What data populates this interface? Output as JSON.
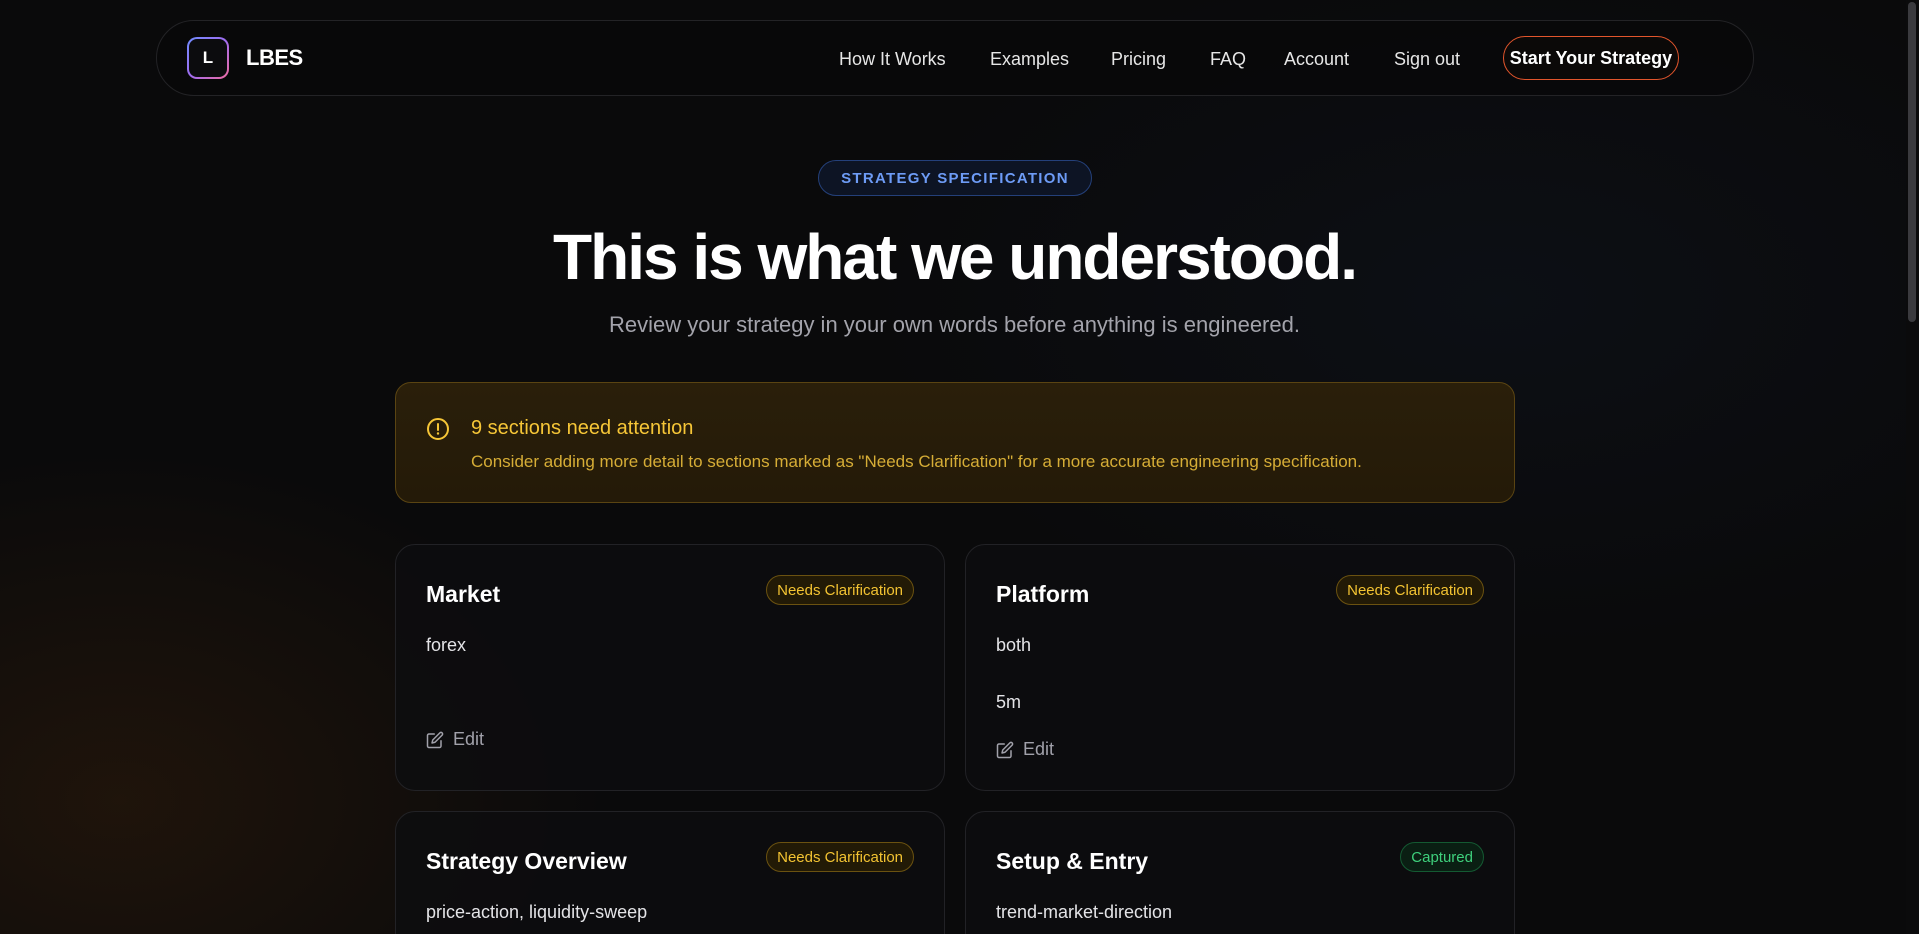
{
  "nav": {
    "logo_letter": "L",
    "brand": "LBES",
    "links": [
      "How It Works",
      "Examples",
      "Pricing",
      "FAQ",
      "Account",
      "Sign out"
    ],
    "cta": "Start Your Strategy"
  },
  "hero": {
    "pill": "STRATEGY SPECIFICATION",
    "title": "This is what we understood.",
    "subtitle": "Review your strategy in your own words before anything is engineered."
  },
  "alert": {
    "icon": "exclamation-circle-icon",
    "title": "9 sections need attention",
    "text": "Consider adding more detail to sections marked as \"Needs Clarification\" for a more accurate engineering specification."
  },
  "cards": [
    {
      "title": "Market",
      "badge": "Needs Clarification",
      "status": "warn",
      "lines": [
        "forex"
      ],
      "edit": "Edit"
    },
    {
      "title": "Platform",
      "badge": "Needs Clarification",
      "status": "warn",
      "lines": [
        "both",
        "5m"
      ],
      "edit": "Edit"
    },
    {
      "title": "Strategy Overview",
      "badge": "Needs Clarification",
      "status": "warn",
      "lines": [
        "price-action, liquidity-sweep"
      ]
    },
    {
      "title": "Setup & Entry",
      "badge": "Captured",
      "status": "ok",
      "lines": [
        "trend-market-direction"
      ]
    }
  ],
  "colors": {
    "background": "#0a0a0b",
    "accent_cta_border": "#e2552c",
    "pill_text": "#6d9bf5",
    "warning": "#f3c332",
    "success": "#3ed07c"
  }
}
